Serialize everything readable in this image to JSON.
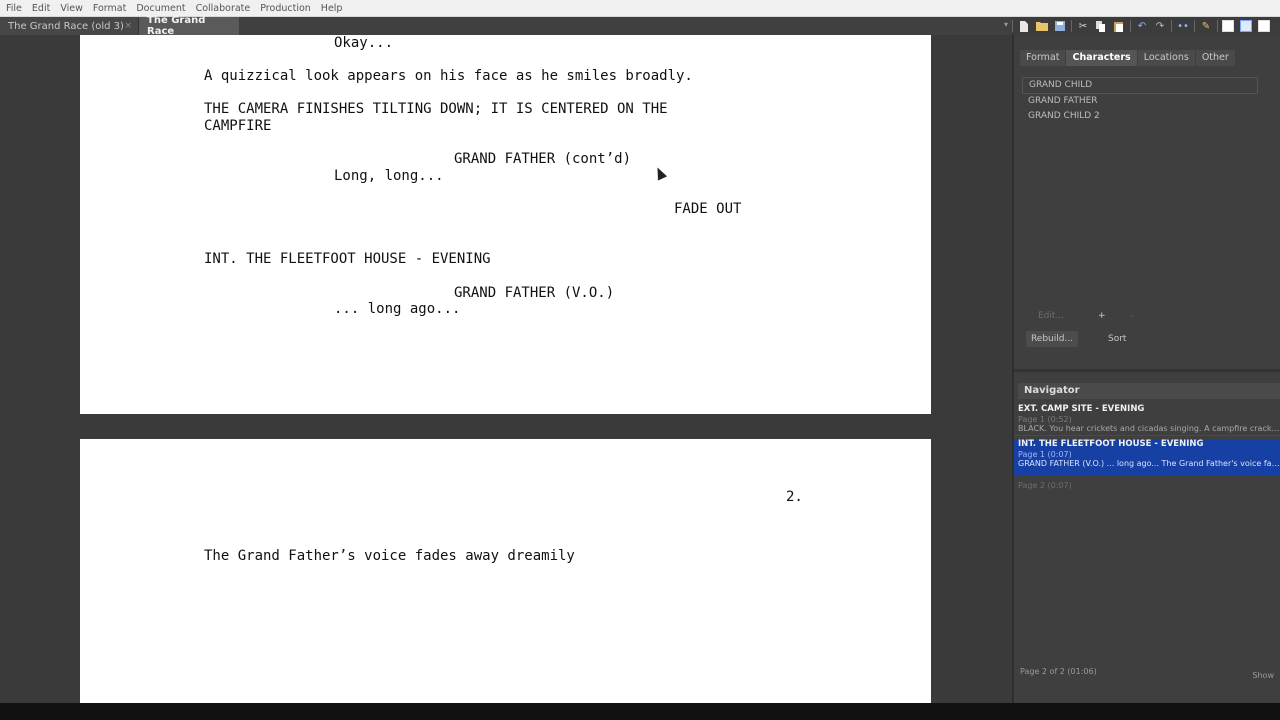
{
  "menu": [
    "File",
    "Edit",
    "View",
    "Format",
    "Document",
    "Collaborate",
    "Production",
    "Help"
  ],
  "tabs": [
    {
      "label": "The Grand Race (old 3)",
      "close": "×"
    },
    {
      "label": "The Grand Race"
    }
  ],
  "toolbar": {
    "icons": [
      "new-document-icon",
      "open-folder-icon",
      "save-icon",
      "cut-icon",
      "copy-icon",
      "paste-icon",
      "undo-icon",
      "redo-icon",
      "more-icon",
      "tools-icon",
      "layout-1-icon",
      "layout-2-icon",
      "layout-3-icon"
    ],
    "menu_arrow": "▾"
  },
  "page1": {
    "lines": [
      "Okay...",
      "A quizzical look appears on his face as he smiles broadly.",
      "THE CAMERA FINISHES TILTING DOWN; IT IS CENTERED ON THE",
      "CAMPFIRE",
      "GRAND FATHER (cont’d)",
      "Long, long...",
      "FADE OUT",
      "INT. THE FLEETFOOT HOUSE - EVENING",
      "GRAND FATHER (V.O.)",
      "... long ago..."
    ]
  },
  "page2": {
    "page_number": "2.",
    "action": "The Grand Father’s voice fades away dreamily"
  },
  "sidepanel": {
    "tabs": [
      "Format",
      "Characters",
      "Locations",
      "Other"
    ],
    "active_tab": "Characters",
    "characters": [
      "GRAND CHILD",
      "GRAND FATHER",
      "GRAND CHILD 2"
    ],
    "edit_label": "Edit...",
    "add_label": "+",
    "remove_label": "-",
    "rebuild_label": "Rebuild...",
    "sort_label": "Sort"
  },
  "navigator": {
    "title": "Navigator",
    "scenes": [
      {
        "heading": "EXT. CAMP SITE - EVENING",
        "meta": "Page 1 (0:52)",
        "synopsis": "BLACK. You hear crickets and cicadas singing. A campfire crackles in t..."
      },
      {
        "heading": "INT. THE FLEETFOOT HOUSE - EVENING",
        "meta": "Page 1 (0:07)",
        "synopsis": "GRAND FATHER (V.O.) ... long ago... The Grand Father's voice fades aw..."
      },
      {
        "heading": "",
        "meta": "Page 2 (0:07)",
        "synopsis": ""
      }
    ],
    "footer_left": "Page 2 of 2 (01:06)",
    "footer_right": "Show"
  }
}
